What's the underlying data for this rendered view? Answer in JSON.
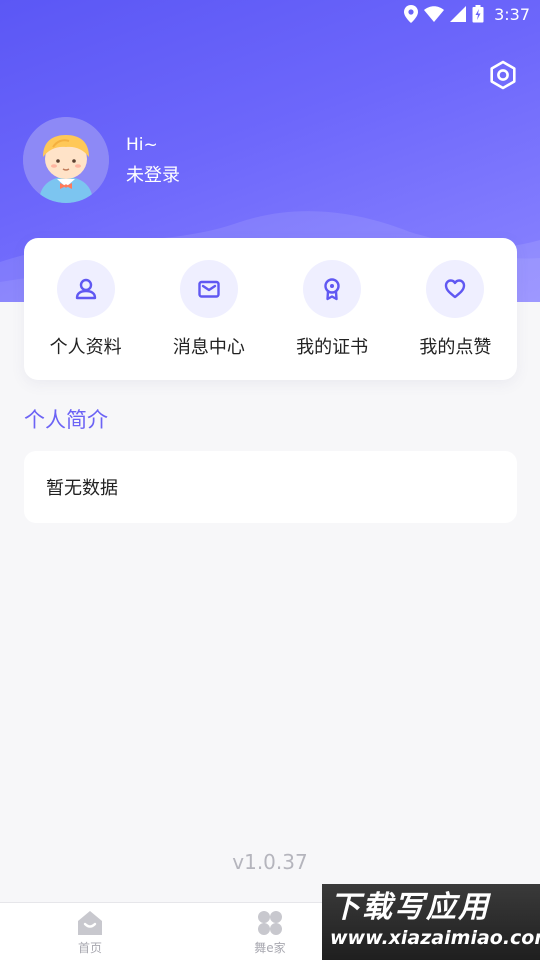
{
  "status_bar": {
    "time": "3:37"
  },
  "profile": {
    "greeting": "Hi~",
    "login_text": "未登录"
  },
  "menu": [
    {
      "label": "个人资料",
      "icon": "user-icon"
    },
    {
      "label": "消息中心",
      "icon": "mail-icon"
    },
    {
      "label": "我的证书",
      "icon": "certificate-icon"
    },
    {
      "label": "我的点赞",
      "icon": "heart-icon"
    }
  ],
  "intro": {
    "title": "个人简介",
    "empty_text": "暂无数据"
  },
  "version": "v1.0.37",
  "tabbar": [
    {
      "label": "首页",
      "icon": "home-icon"
    },
    {
      "label": "舞e家",
      "icon": "clover-icon"
    }
  ],
  "watermark": {
    "title": "下载写应用",
    "url": "www.xiazaimiao.com"
  },
  "colors": {
    "accent": "#6c63f5",
    "header_start": "#5b57f5",
    "header_end": "#8a84ff",
    "icon_bg": "#efefff"
  }
}
